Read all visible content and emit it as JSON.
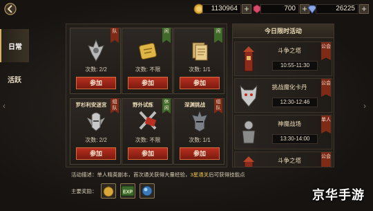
{
  "currencies": [
    {
      "icon": "gold-coin-icon",
      "value": "1130964",
      "color": "#d9a83a"
    },
    {
      "icon": "ruby-gem-icon",
      "value": "700",
      "color": "#d84a6a"
    },
    {
      "icon": "diamond-icon",
      "value": "26225",
      "color": "#8aa8e8"
    }
  ],
  "plus_label": "+",
  "tabs": [
    {
      "label": "日常",
      "active": true
    },
    {
      "label": "活跃",
      "active": false
    }
  ],
  "nav": {
    "left_arrow": "‹",
    "right_arrow": "›"
  },
  "activities": [
    {
      "title": "",
      "tag": "队",
      "tag_color": "red",
      "icon": "halberd-crest-icon",
      "count": "次数: 2/2",
      "button": "参加"
    },
    {
      "title": "",
      "tag": "闲",
      "tag_color": "green",
      "icon": "gold-scroll-icon",
      "count": "次数: 不限",
      "button": "参加"
    },
    {
      "title": "",
      "tag": "闲",
      "tag_color": "green",
      "icon": "paper-sheets-icon",
      "count": "次数: 1/1",
      "button": "参加"
    },
    {
      "title": "罗杉利安迷宫",
      "tag": "组队",
      "tag_color": "red",
      "icon": "winged-helmet-icon",
      "count": "次数: 2/2",
      "button": "参加"
    },
    {
      "title": "野外试炼",
      "tag": "休闲",
      "tag_color": "green",
      "icon": "crossed-swords-icon",
      "count": "次数: 不限",
      "button": "参加"
    },
    {
      "title": "深渊挑战",
      "tag": "组队",
      "tag_color": "red",
      "icon": "dark-knight-helm-icon",
      "count": "次数: 1/1",
      "button": "参加"
    }
  ],
  "description": {
    "label": "活动描述：",
    "text_1": "单人精英副本，首次通关获得大量经验，",
    "highlight": "3星通关",
    "text_2": "后可获得技能点"
  },
  "rewards": {
    "label": "主要奖励：",
    "items": [
      {
        "icon": "coin-bag-icon"
      },
      {
        "icon": "exp-badge-icon",
        "text": "EXP"
      },
      {
        "icon": "skill-orb-icon"
      }
    ]
  },
  "limited": {
    "title": "今日限时活动",
    "events": [
      {
        "name": "斗争之塔",
        "time": "10:55-11:30",
        "tag": "公会",
        "icon": "tower-icon"
      },
      {
        "name": "挑战魔化卡丹",
        "time": "12:30-12:46",
        "tag": "公会",
        "icon": "demon-mask-icon"
      },
      {
        "name": "神魔战场",
        "time": "13:30-14:00",
        "tag": "单人",
        "icon": "armored-warrior-icon"
      },
      {
        "name": "斗争之塔",
        "time": "",
        "tag": "公会",
        "icon": "tower-icon"
      }
    ]
  },
  "watermark": "京华手游"
}
